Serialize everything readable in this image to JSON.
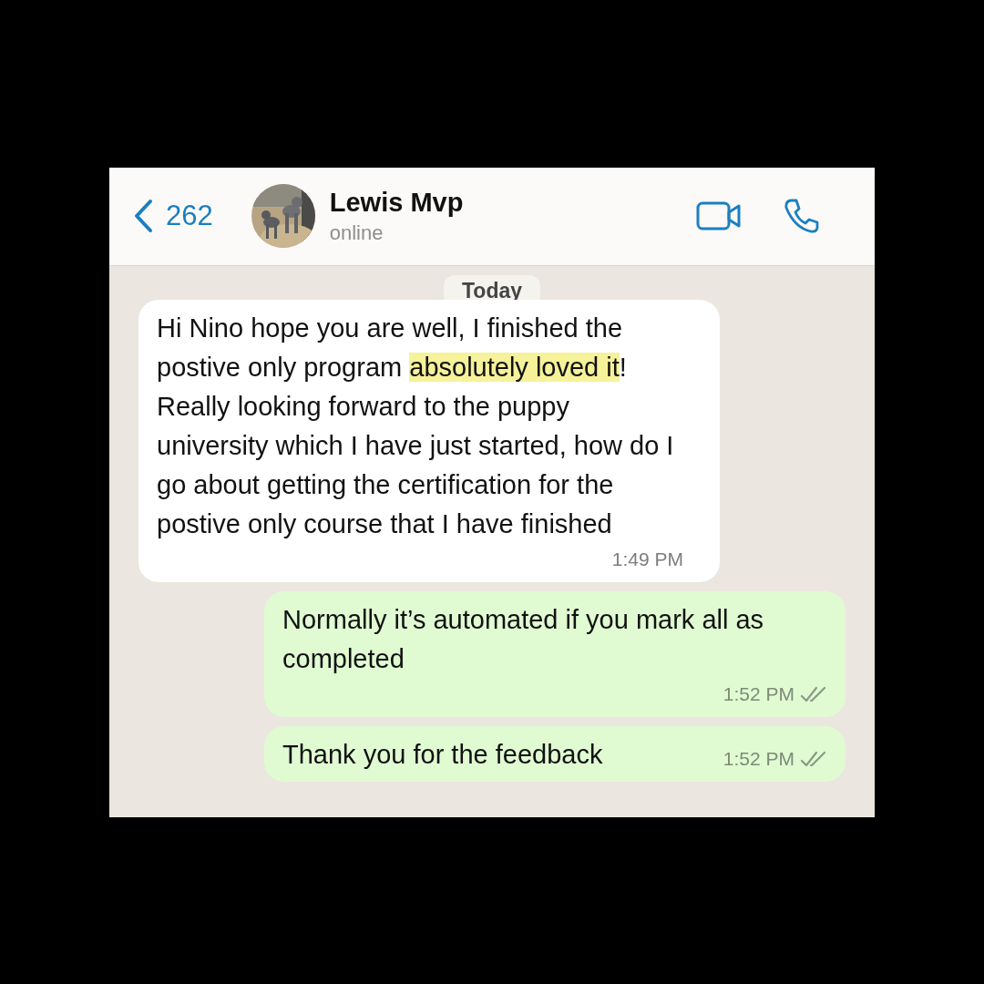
{
  "header": {
    "back_count": "262",
    "contact": {
      "name": "Lewis Mvp",
      "status": "online"
    }
  },
  "date_label": "Today",
  "messages": [
    {
      "outgoing": false,
      "segments": [
        {
          "text": "Hi Nino hope you are well, I finished the postive only program ",
          "highlighted": false
        },
        {
          "text": "absolutely loved it",
          "highlighted": true
        },
        {
          "text": "! Really looking forward to the puppy university which I have just started, how do I go about getting the certification for the postive only course that I have finished",
          "highlighted": false
        }
      ],
      "time": "1:49 PM"
    },
    {
      "outgoing": true,
      "segments": [
        {
          "text": "Normally it’s automated if you mark all as completed",
          "highlighted": false
        }
      ],
      "time": "1:52 PM",
      "read": false
    },
    {
      "outgoing": true,
      "segments": [
        {
          "text": "Thank you for the feedback",
          "highlighted": false
        }
      ],
      "time": "1:52 PM",
      "read": false
    }
  ]
}
